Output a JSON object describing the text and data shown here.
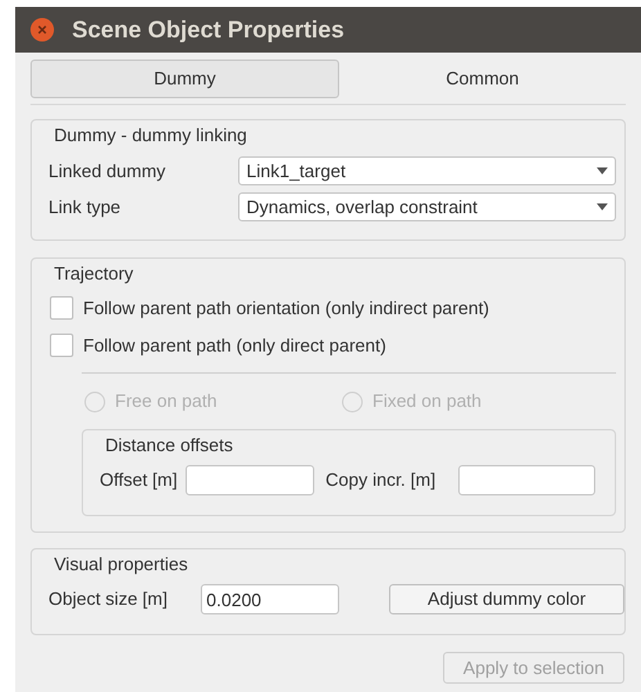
{
  "window": {
    "title": "Scene Object Properties"
  },
  "tabs": [
    {
      "label": "Dummy",
      "selected": true
    },
    {
      "label": "Common",
      "selected": false
    }
  ],
  "linking": {
    "title": "Dummy - dummy linking",
    "rows": [
      {
        "label": "Linked dummy",
        "value": "Link1_target"
      },
      {
        "label": "Link type",
        "value": "Dynamics, overlap constraint"
      }
    ]
  },
  "trajectory": {
    "title": "Trajectory",
    "checkboxes": [
      {
        "label": "Follow parent path orientation (only indirect parent)",
        "checked": false
      },
      {
        "label": "Follow parent path (only direct parent)",
        "checked": false
      }
    ],
    "radios": [
      {
        "label": "Free on path",
        "selected": false,
        "disabled": true
      },
      {
        "label": "Fixed on path",
        "selected": false,
        "disabled": true
      }
    ],
    "offsets": {
      "title": "Distance offsets",
      "fields": [
        {
          "label": "Offset [m]"
        },
        {
          "label": "Copy incr. [m]"
        }
      ]
    }
  },
  "visual": {
    "title": "Visual properties",
    "size_label": "Object size [m]",
    "size_value": "0.0200",
    "button": "Adjust dummy color"
  },
  "apply_button": {
    "label": "Apply to selection",
    "disabled": true
  }
}
